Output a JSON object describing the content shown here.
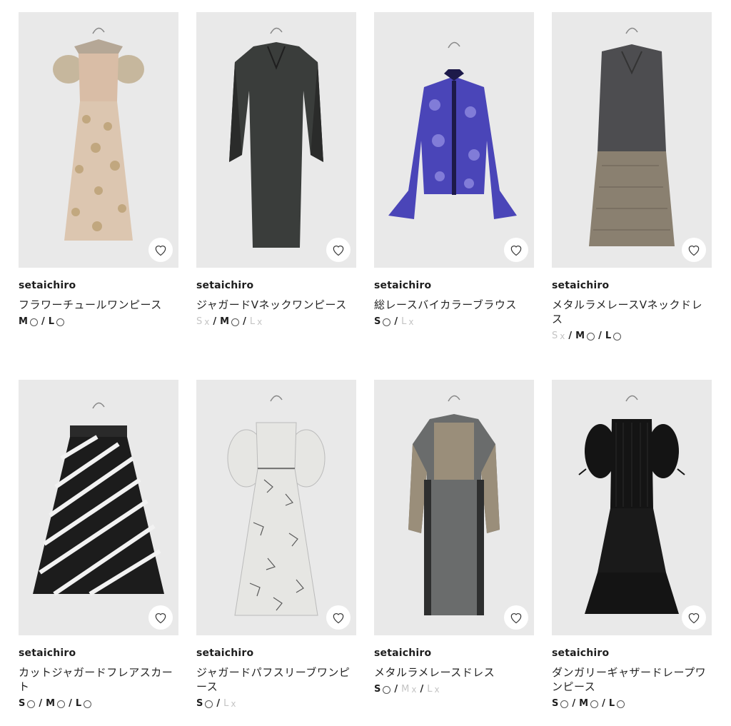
{
  "products": [
    {
      "brand": "setaichiro",
      "name": "フラワーチュールワンピース",
      "sizes": [
        {
          "label": "M",
          "available": true
        },
        {
          "label": "L",
          "available": true
        }
      ],
      "garment": "dress-tulle",
      "colors": {
        "main": "#d8bfa6",
        "accent": "#c3a57e"
      }
    },
    {
      "brand": "setaichiro",
      "name": "ジャガードVネックワンピース",
      "sizes": [
        {
          "label": "S",
          "available": false
        },
        {
          "label": "M",
          "available": true
        },
        {
          "label": "L",
          "available": false
        }
      ],
      "garment": "dress-vneck",
      "colors": {
        "main": "#3a3d3b",
        "accent": "#262827"
      }
    },
    {
      "brand": "setaichiro",
      "name": "総レースバイカラーブラウス",
      "sizes": [
        {
          "label": "S",
          "available": true
        },
        {
          "label": "L",
          "available": false
        }
      ],
      "garment": "blouse",
      "colors": {
        "main": "#4a45b8",
        "accent": "#1d1a4a"
      }
    },
    {
      "brand": "setaichiro",
      "name": "メタルラメレースVネックドレス",
      "sizes": [
        {
          "label": "S",
          "available": false
        },
        {
          "label": "M",
          "available": true
        },
        {
          "label": "L",
          "available": true
        }
      ],
      "garment": "dress-vest",
      "colors": {
        "main": "#4d4d50",
        "accent": "#8a8070"
      }
    },
    {
      "brand": "setaichiro",
      "name": "カットジャガードフレアスカート",
      "sizes": [
        {
          "label": "S",
          "available": true
        },
        {
          "label": "M",
          "available": true
        },
        {
          "label": "L",
          "available": true
        }
      ],
      "garment": "skirt-stripe",
      "colors": {
        "main": "#1c1c1c",
        "accent": "#f2f2f2"
      }
    },
    {
      "brand": "setaichiro",
      "name": "ジャガードパフスリーブワンピース",
      "sizes": [
        {
          "label": "S",
          "available": true
        },
        {
          "label": "L",
          "available": false
        }
      ],
      "garment": "dress-puff",
      "colors": {
        "main": "#e6e6e3",
        "accent": "#5a5a5a"
      }
    },
    {
      "brand": "setaichiro",
      "name": "メタルラメレースドレス",
      "sizes": [
        {
          "label": "S",
          "available": true
        },
        {
          "label": "M",
          "available": false
        },
        {
          "label": "L",
          "available": false
        }
      ],
      "garment": "dress-lace",
      "colors": {
        "main": "#6a6c6c",
        "accent": "#9a8e7a"
      }
    },
    {
      "brand": "setaichiro",
      "name": "ダンガリーギャザードレープワンピース",
      "sizes": [
        {
          "label": "S",
          "available": true
        },
        {
          "label": "M",
          "available": true
        },
        {
          "label": "L",
          "available": true
        }
      ],
      "garment": "dress-black",
      "colors": {
        "main": "#141414",
        "accent": "#2a2a2a"
      }
    }
  ],
  "icons": {
    "favorite": "heart-outline-icon",
    "available": "circle-icon",
    "unavailable": "cross-icon"
  },
  "colors": {
    "photo_bg": "#e9e9e9",
    "text": "#1e1e1e",
    "muted": "#c4c4c4"
  }
}
